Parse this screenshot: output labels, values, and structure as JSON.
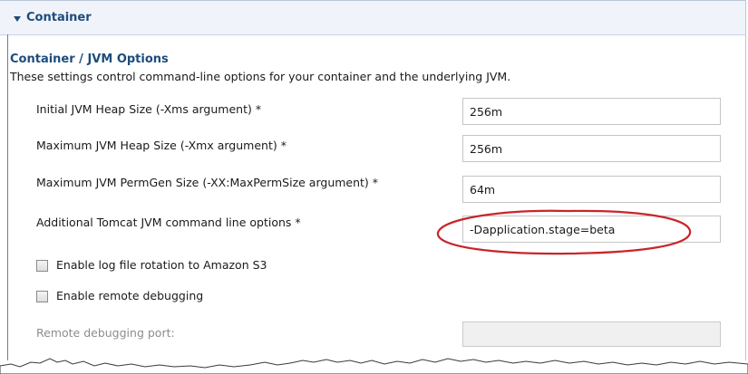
{
  "section": {
    "title": "Container",
    "toggle_icon": "expanded-triangle-icon"
  },
  "group": {
    "title": "Container / JVM Options",
    "description": "These settings control command-line options for your container and the underlying JVM."
  },
  "fields": {
    "initial_heap": {
      "label": "Initial JVM Heap Size (-Xms argument) *",
      "value": "256m"
    },
    "max_heap": {
      "label": "Maximum JVM Heap Size (-Xmx argument) *",
      "value": "256m"
    },
    "max_permgen": {
      "label": "Maximum JVM PermGen Size (-XX:MaxPermSize argument) *",
      "value": "64m"
    },
    "tomcat_options": {
      "label": "Additional Tomcat JVM command line options *",
      "value": "-Dapplication.stage=beta"
    },
    "remote_port": {
      "label": "Remote debugging port:",
      "value": ""
    }
  },
  "checkboxes": {
    "log_rotation": {
      "label": "Enable log file rotation to Amazon S3",
      "checked": false
    },
    "remote_debugging": {
      "label": "Enable remote debugging",
      "checked": false
    }
  },
  "colors": {
    "section_title": "#1d4c7c",
    "highlight_annotation": "#c8262b"
  }
}
